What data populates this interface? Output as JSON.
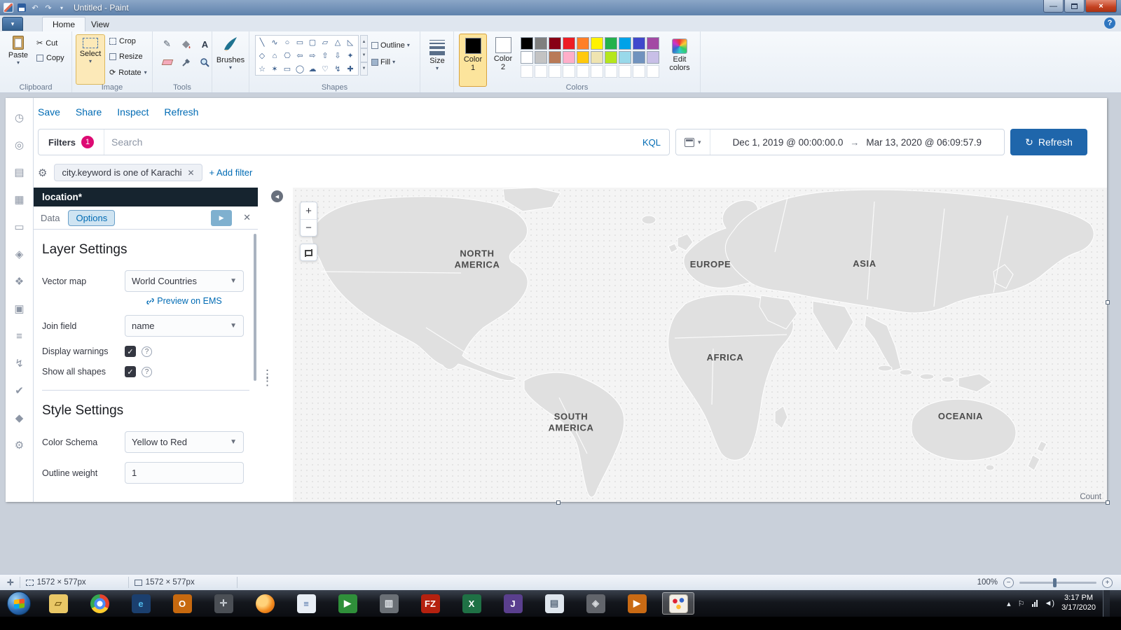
{
  "paint": {
    "window_title": "Untitled - Paint",
    "menu_tabs": [
      "Home",
      "View"
    ],
    "ribbon": {
      "paste": "Paste",
      "cut": "Cut",
      "copy": "Copy",
      "select": "Select",
      "crop": "Crop",
      "resize": "Resize",
      "rotate": "Rotate",
      "brushes": "Brushes",
      "outline": "Outline",
      "fill": "Fill",
      "size": "Size",
      "color1": "Color 1",
      "color2": "Color 2",
      "edit_colors": "Edit colors",
      "group_labels": [
        "Clipboard",
        "Image",
        "Tools",
        "Shapes",
        "Colors"
      ]
    },
    "shapes_items": [
      {
        "name": "line",
        "glyph": "╲"
      },
      {
        "name": "curve",
        "glyph": "∿"
      },
      {
        "name": "oval",
        "glyph": "○"
      },
      {
        "name": "rectangle",
        "glyph": "▭"
      },
      {
        "name": "rounded-rectangle",
        "glyph": "▢"
      },
      {
        "name": "polygon",
        "glyph": "▱"
      },
      {
        "name": "triangle",
        "glyph": "△"
      },
      {
        "name": "right-triangle",
        "glyph": "◺"
      },
      {
        "name": "diamond",
        "glyph": "◇"
      },
      {
        "name": "pentagon",
        "glyph": "⌂"
      },
      {
        "name": "hexagon",
        "glyph": "⎔"
      },
      {
        "name": "left-arrow",
        "glyph": "⇦"
      },
      {
        "name": "right-arrow",
        "glyph": "⇨"
      },
      {
        "name": "up-arrow",
        "glyph": "⇧"
      },
      {
        "name": "down-arrow",
        "glyph": "⇩"
      },
      {
        "name": "four-point-star",
        "glyph": "✦"
      },
      {
        "name": "five-point-star",
        "glyph": "☆"
      },
      {
        "name": "six-point-star",
        "glyph": "✶"
      },
      {
        "name": "rounded-callout",
        "glyph": "▭"
      },
      {
        "name": "oval-callout",
        "glyph": "◯"
      },
      {
        "name": "cloud-callout",
        "glyph": "☁"
      },
      {
        "name": "heart",
        "glyph": "♡"
      },
      {
        "name": "lightning",
        "glyph": "↯"
      },
      {
        "name": "cross",
        "glyph": "✚"
      }
    ],
    "palette_row1": [
      "#000000",
      "#7f7f7f",
      "#880015",
      "#ed1c24",
      "#ff7f27",
      "#fff200",
      "#22b14c",
      "#00a2e8",
      "#3f48cc",
      "#a349a4"
    ],
    "palette_row2": [
      "#ffffff",
      "#c3c3c3",
      "#b97a57",
      "#ffaec9",
      "#ffc90e",
      "#efe4b0",
      "#b5e61d",
      "#99d9ea",
      "#7092be",
      "#c8bfe7"
    ],
    "palette_empty_count": 10,
    "status": {
      "selection_size": "1572 × 577px",
      "image_size": "1572 × 577px",
      "zoom": "100%"
    }
  },
  "kibana": {
    "menu": [
      "Save",
      "Share",
      "Inspect",
      "Refresh"
    ],
    "filter_bar": {
      "filters_label": "Filters",
      "filters_count": "1",
      "search_placeholder": "Search",
      "kql_label": "KQL",
      "date_from": "Dec 1, 2019 @ 00:00:00.0",
      "date_to": "Mar 13, 2020 @ 06:09:57.9",
      "refresh_label": "Refresh"
    },
    "filter_pill": "city.keyword is one of Karachi",
    "add_filter_label": "+ Add filter",
    "sidebar_icons": [
      {
        "name": "recently-viewed",
        "glyph": "◷"
      },
      {
        "name": "discover",
        "glyph": "◎"
      },
      {
        "name": "visualize",
        "glyph": "▤"
      },
      {
        "name": "dashboard",
        "glyph": "▦"
      },
      {
        "name": "canvas",
        "glyph": "▭"
      },
      {
        "name": "maps",
        "glyph": "◈"
      },
      {
        "name": "machine-learning",
        "glyph": "❖"
      },
      {
        "name": "metrics",
        "glyph": "▣"
      },
      {
        "name": "logs",
        "glyph": "≡"
      },
      {
        "name": "apm",
        "glyph": "↯"
      },
      {
        "name": "uptime",
        "glyph": "✔"
      },
      {
        "name": "siem",
        "glyph": "◆"
      },
      {
        "name": "management",
        "glyph": "⚙"
      }
    ],
    "panel": {
      "title": "location*",
      "tab_data": "Data",
      "tab_options": "Options",
      "layer_settings_title": "Layer Settings",
      "vector_map_label": "Vector map",
      "vector_map_value": "World Countries",
      "preview_link": "Preview on EMS",
      "join_field_label": "Join field",
      "join_field_value": "name",
      "display_warnings_label": "Display warnings",
      "show_all_shapes_label": "Show all shapes",
      "style_settings_title": "Style Settings",
      "color_schema_label": "Color Schema",
      "color_schema_value": "Yellow to Red",
      "outline_weight_label": "Outline weight",
      "outline_weight_value": "1"
    },
    "map": {
      "labels": [
        "NORTH AMERICA",
        "EUROPE",
        "ASIA",
        "AFRICA",
        "SOUTH AMERICA",
        "OCEANIA"
      ],
      "zoom_in": "+",
      "zoom_out": "−",
      "count_label": "Count"
    }
  },
  "taskbar": {
    "icons": [
      {
        "name": "windows-explorer",
        "glyph": "▱",
        "bg": "#e9c766",
        "fg": "#7a5b12"
      },
      {
        "name": "chrome",
        "glyph": "",
        "css": true
      },
      {
        "name": "internet-explorer",
        "glyph": "e",
        "bg": "#1b3f6e",
        "fg": "#4fb9ea"
      },
      {
        "name": "outlook",
        "glyph": "O",
        "bg": "#c7690f",
        "fg": "#ffffff"
      },
      {
        "name": "system-config",
        "glyph": "✛",
        "bg": "#4b4f55",
        "fg": "#cfd4da"
      },
      {
        "name": "firefox",
        "glyph": "",
        "css": true
      },
      {
        "name": "wordpad",
        "glyph": "≡",
        "bg": "#e8eef5",
        "fg": "#4a6fa5"
      },
      {
        "name": "media-share",
        "glyph": "▶",
        "bg": "#2f8f3a",
        "fg": "#ffffff"
      },
      {
        "name": "monitor-app",
        "glyph": "▥",
        "bg": "#6b7076",
        "fg": "#e0e4e8"
      },
      {
        "name": "filezilla",
        "glyph": "FZ",
        "bg": "#b5210f",
        "fg": "#ffffff"
      },
      {
        "name": "excel",
        "glyph": "X",
        "bg": "#1f7145",
        "fg": "#ffffff"
      },
      {
        "name": "purple-app",
        "glyph": "J",
        "bg": "#5a3f8e",
        "fg": "#ffffff"
      },
      {
        "name": "notepad",
        "glyph": "▤",
        "bg": "#dfe6ee",
        "fg": "#5a6a7d"
      },
      {
        "name": "remote-app",
        "glyph": "◈",
        "bg": "#62656b",
        "fg": "#d7dadd"
      },
      {
        "name": "media-player",
        "glyph": "▶",
        "bg": "#c96a14",
        "fg": "#ffffff"
      },
      {
        "name": "paint",
        "glyph": "",
        "css": true,
        "active": true
      }
    ],
    "time": "3:17 PM",
    "date": "3/17/2020"
  },
  "colors": {
    "accent_blue": "#006BB4",
    "badge_pink": "#dd0a73",
    "refresh_button": "#1f66ab",
    "panel_header": "#16242f"
  }
}
